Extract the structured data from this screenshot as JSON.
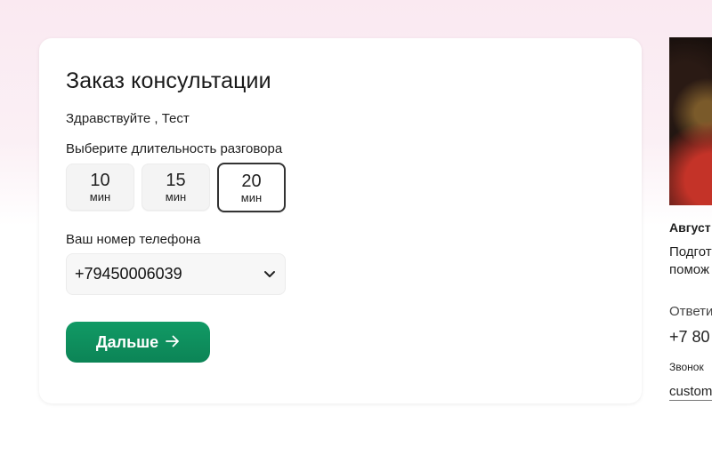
{
  "form": {
    "title": "Заказ консультации",
    "greeting": "Здравствуйте , Тест",
    "duration_label": "Выберите длительность разговора",
    "durations": [
      {
        "value": "10",
        "unit": "мин",
        "selected": false
      },
      {
        "value": "15",
        "unit": "мин",
        "selected": false
      },
      {
        "value": "20",
        "unit": "мин",
        "selected": true
      }
    ],
    "phone_label": "Ваш номер телефона",
    "phone_value": "+79450006039",
    "next_label": "Дальше",
    "accent_color": "#0e8f5e"
  },
  "side": {
    "name_partial": "Август",
    "desc_line1": "Подгот",
    "desc_line2": "помож",
    "answer_label": "Ответи",
    "phone_partial": "+7 80",
    "call_note_partial": "Звонок",
    "email_partial": "custom"
  }
}
